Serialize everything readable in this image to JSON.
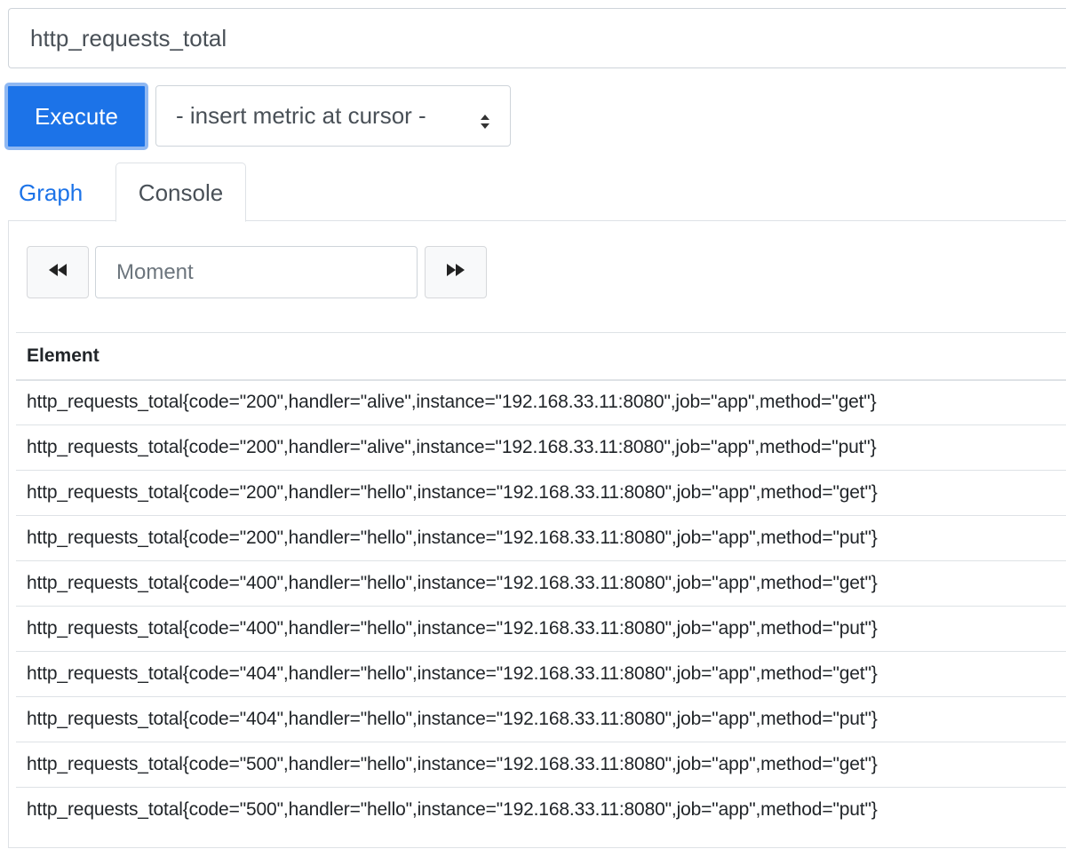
{
  "expression": {
    "value": "http_requests_total"
  },
  "toolbar": {
    "execute_label": "Execute",
    "insert_metric_label": "- insert metric at cursor -"
  },
  "tabs": [
    {
      "label": "Graph",
      "active": false
    },
    {
      "label": "Console",
      "active": true
    }
  ],
  "console": {
    "moment_placeholder": "Moment",
    "table": {
      "header": "Element",
      "rows": [
        "http_requests_total{code=\"200\",handler=\"alive\",instance=\"192.168.33.11:8080\",job=\"app\",method=\"get\"}",
        "http_requests_total{code=\"200\",handler=\"alive\",instance=\"192.168.33.11:8080\",job=\"app\",method=\"put\"}",
        "http_requests_total{code=\"200\",handler=\"hello\",instance=\"192.168.33.11:8080\",job=\"app\",method=\"get\"}",
        "http_requests_total{code=\"200\",handler=\"hello\",instance=\"192.168.33.11:8080\",job=\"app\",method=\"put\"}",
        "http_requests_total{code=\"400\",handler=\"hello\",instance=\"192.168.33.11:8080\",job=\"app\",method=\"get\"}",
        "http_requests_total{code=\"400\",handler=\"hello\",instance=\"192.168.33.11:8080\",job=\"app\",method=\"put\"}",
        "http_requests_total{code=\"404\",handler=\"hello\",instance=\"192.168.33.11:8080\",job=\"app\",method=\"get\"}",
        "http_requests_total{code=\"404\",handler=\"hello\",instance=\"192.168.33.11:8080\",job=\"app\",method=\"put\"}",
        "http_requests_total{code=\"500\",handler=\"hello\",instance=\"192.168.33.11:8080\",job=\"app\",method=\"get\"}",
        "http_requests_total{code=\"500\",handler=\"hello\",instance=\"192.168.33.11:8080\",job=\"app\",method=\"put\"}"
      ]
    }
  },
  "icons": {
    "back": "fast-backward-icon",
    "forward": "fast-forward-icon",
    "select_arrow": "select-updown-icon"
  },
  "colors": {
    "accent": "#1c73e8",
    "execute_focus_ring": "#8fb8f2",
    "border": "#dee2e6"
  }
}
